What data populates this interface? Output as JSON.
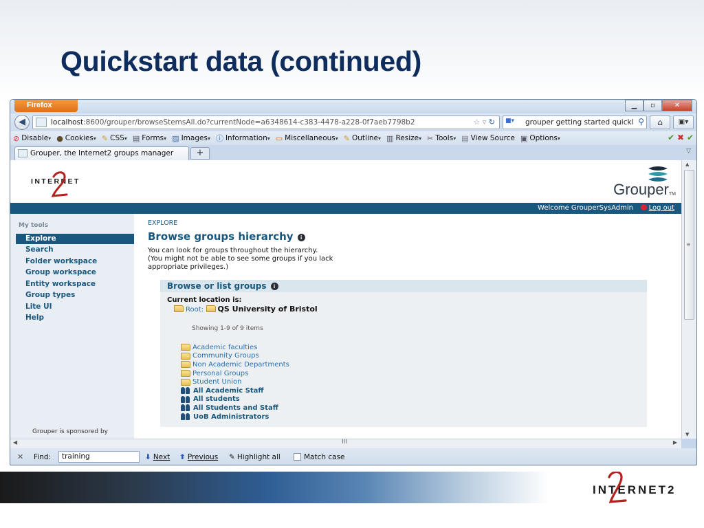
{
  "slide": {
    "title": "Quickstart data (continued)",
    "footer_logo": "INTERNET2"
  },
  "browser": {
    "firefox_button": "Firefox",
    "url_host": "localhost",
    "url_rest": ":8600/grouper/browseStemsAll.do?currentNode=a6348614-c383-4478-a228-0f7aeb7798b2",
    "search_text": "grouper getting started quickly",
    "devbar": [
      {
        "icon": "disable-icon",
        "label": "Disable"
      },
      {
        "icon": "cookies-icon",
        "label": "Cookies"
      },
      {
        "icon": "css-icon",
        "label": "CSS"
      },
      {
        "icon": "forms-icon",
        "label": "Forms"
      },
      {
        "icon": "images-icon",
        "label": "Images"
      },
      {
        "icon": "information-icon",
        "label": "Information"
      },
      {
        "icon": "miscellaneous-icon",
        "label": "Miscellaneous"
      },
      {
        "icon": "outline-icon",
        "label": "Outline"
      },
      {
        "icon": "resize-icon",
        "label": "Resize"
      },
      {
        "icon": "tools-icon",
        "label": "Tools"
      },
      {
        "icon": "view-source-icon",
        "label": "View Source"
      },
      {
        "icon": "options-icon",
        "label": "Options"
      }
    ],
    "tab_title": "Grouper, the Internet2 groups manager",
    "find": {
      "label": "Find:",
      "value": "training",
      "next": "Next",
      "previous": "Previous",
      "highlight": "Highlight all",
      "match_case": "Match case"
    }
  },
  "grouper": {
    "logo_text": "INTERNET",
    "brand": "Grouper",
    "welcome": "Welcome GrouperSysAdmin",
    "logout": "Log out",
    "sidebar": {
      "heading": "My tools",
      "items": [
        "Explore",
        "Search",
        "Folder workspace",
        "Group workspace",
        "Entity workspace",
        "Group types",
        "Lite UI",
        "Help"
      ],
      "active_index": 0,
      "sponsor": "Grouper is sponsored by"
    },
    "breadcrumb": "EXPLORE",
    "page_title": "Browse groups hierarchy",
    "intro_lines": [
      "You can look for groups throughout the hierarchy.",
      "(You might not be able to see some groups if you lack",
      "appropriate privileges.)"
    ],
    "box": {
      "title": "Browse or list groups",
      "current_location_label": "Current location is:",
      "root_label": "Root:",
      "current_folder": "QS University of Bristol",
      "showing": "Showing 1-9 of 9 items",
      "items": [
        {
          "type": "folder",
          "label": "Academic faculties"
        },
        {
          "type": "folder",
          "label": "Community Groups"
        },
        {
          "type": "folder",
          "label": "Non Academic Departments"
        },
        {
          "type": "folder",
          "label": "Personal Groups"
        },
        {
          "type": "folder",
          "label": "Student Union"
        },
        {
          "type": "group",
          "label": "All Academic Staff"
        },
        {
          "type": "group",
          "label": "All students"
        },
        {
          "type": "group",
          "label": "All Students and Staff"
        },
        {
          "type": "group",
          "label": "UoB Administrators"
        }
      ]
    }
  },
  "colors": {
    "slide_title": "#0e2c5c",
    "grouper_primary": "#19587e",
    "link": "#2a6fb0"
  }
}
